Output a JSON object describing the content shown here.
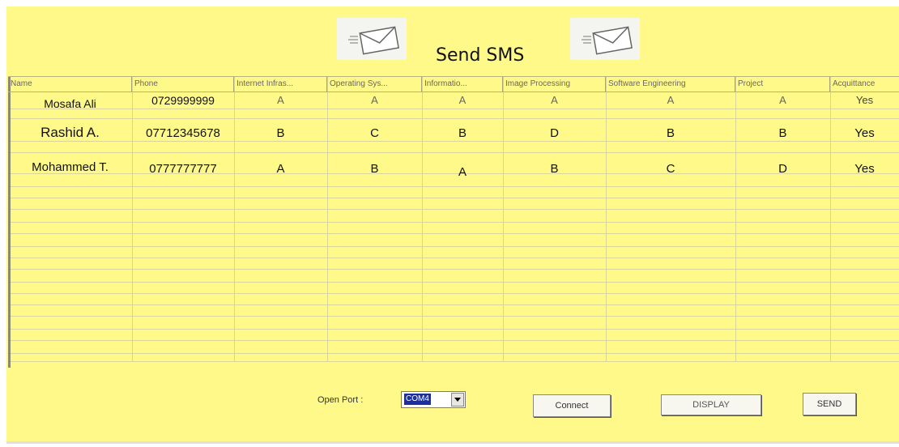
{
  "window": {
    "title": "Send SMS"
  },
  "icons": [
    "envelope-icon",
    "envelope-icon"
  ],
  "table": {
    "columns": [
      "Name",
      "Phone",
      "Internet Infras...",
      "Operating Sys...",
      "Informatio...",
      "Image Processing",
      "Software Engineering",
      "Project",
      "Acquittance"
    ],
    "rows": [
      [
        "Mosafa Ali",
        "0729999999",
        "A",
        "A",
        "A",
        "A",
        "A",
        "A",
        "Yes"
      ],
      [
        "Rashid A.",
        "07712345678",
        "B",
        "C",
        "B",
        "D",
        "B",
        "B",
        "Yes"
      ],
      [
        "Mohammed T.",
        "0777777777",
        "A",
        "B",
        "A",
        "B",
        "C",
        "D",
        "Yes"
      ]
    ]
  },
  "controls": {
    "open_port_label": "Open Port :",
    "port_value": "COM4",
    "connect_label": "Connect",
    "display_label": "DISPLAY",
    "send_label": "SEND"
  },
  "colors": {
    "background": "#fff98a",
    "selection": "#1b2fa0"
  }
}
